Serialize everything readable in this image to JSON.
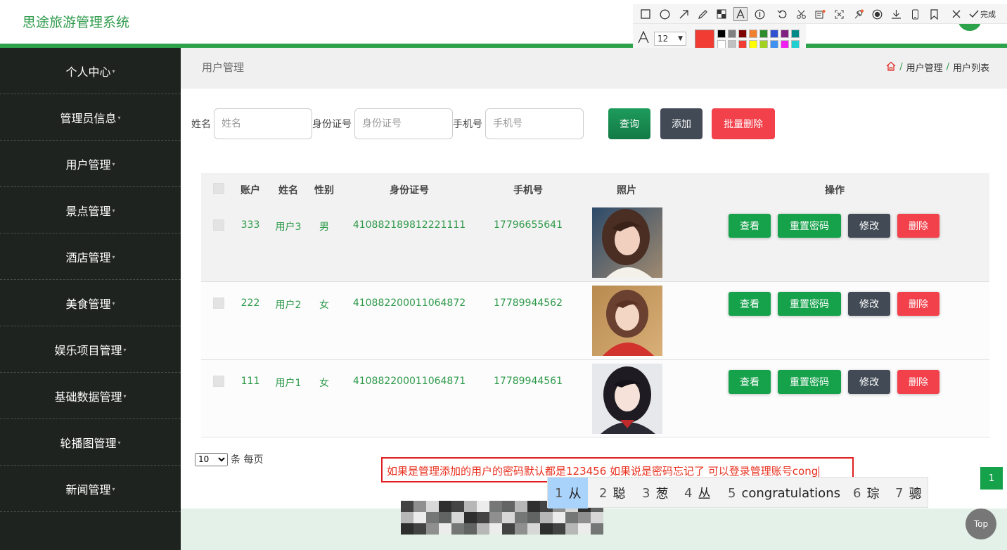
{
  "app": {
    "title": "思途旅游管理系统"
  },
  "screenshot_tool": {
    "font_size": "12",
    "done_label": "完成",
    "current_color": "#f03c32",
    "palette": [
      "#000000",
      "#808080",
      "#800000",
      "#f08030",
      "#2e8b2e",
      "#3050d0",
      "#802080",
      "#008a8a",
      "#ffffff",
      "#c0c0c0",
      "#f03c32",
      "#ffff00",
      "#a0d020",
      "#4090f0",
      "#f020f0",
      "#20d0d0"
    ]
  },
  "sidebar": {
    "items": [
      {
        "label": "个人中心"
      },
      {
        "label": "管理员信息"
      },
      {
        "label": "用户管理"
      },
      {
        "label": "景点管理"
      },
      {
        "label": "酒店管理"
      },
      {
        "label": "美食管理"
      },
      {
        "label": "娱乐项目管理"
      },
      {
        "label": "基础数据管理"
      },
      {
        "label": "轮播图管理"
      },
      {
        "label": "新闻管理"
      }
    ]
  },
  "page": {
    "title": "用户管理",
    "breadcrumb": [
      "用户管理",
      "用户列表"
    ]
  },
  "search": {
    "name_label": "姓名",
    "name_placeholder": "姓名",
    "id_label": "身份证号",
    "id_placeholder": "身份证号",
    "phone_label": "手机号",
    "phone_placeholder": "手机号",
    "query_label": "查询",
    "add_label": "添加",
    "batch_delete_label": "批量删除"
  },
  "table": {
    "headers": [
      "账户",
      "姓名",
      "性别",
      "身份证号",
      "手机号",
      "照片",
      "操作"
    ],
    "rows": [
      {
        "account": "333",
        "name": "用户3",
        "gender": "男",
        "id_number": "410882189812221111",
        "phone": "17796655641"
      },
      {
        "account": "222",
        "name": "用户2",
        "gender": "女",
        "id_number": "410882200011064872",
        "phone": "17789944562"
      },
      {
        "account": "111",
        "name": "用户1",
        "gender": "女",
        "id_number": "410882200011064871",
        "phone": "17789944561"
      }
    ],
    "actions": {
      "view": "查看",
      "reset": "重置密码",
      "edit": "修改",
      "delete": "删除"
    }
  },
  "pagination": {
    "page_size": "10",
    "per_page_label": "条 每页",
    "current_page": "1"
  },
  "top_button": "Top",
  "annotation": {
    "text": "如果是管理添加的用户的密码默认都是123456 如果说是密码忘记了 可以登录管理账号cong"
  },
  "ime": {
    "candidates": [
      {
        "n": "1",
        "text": "从"
      },
      {
        "n": "2",
        "text": "聪"
      },
      {
        "n": "3",
        "text": "葱"
      },
      {
        "n": "4",
        "text": "丛"
      },
      {
        "n": "5",
        "text": "congratulations"
      },
      {
        "n": "6",
        "text": "琮"
      },
      {
        "n": "7",
        "text": "骢"
      }
    ]
  },
  "colors": {
    "brand_green": "#2ca24b",
    "danger": "#f2414b",
    "dark_button": "#414a55"
  }
}
